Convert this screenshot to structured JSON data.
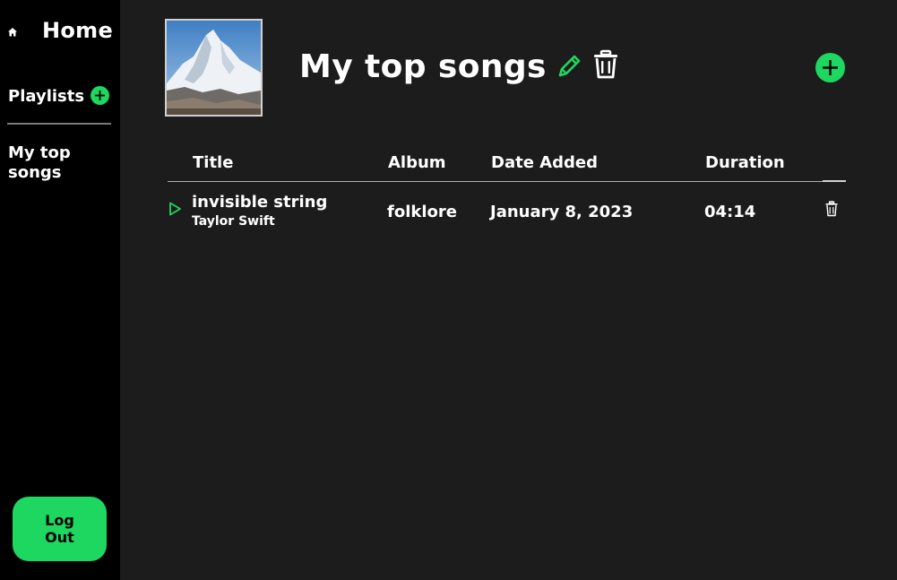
{
  "colors": {
    "accent": "#1ed760",
    "sidebar_bg": "#000000",
    "main_bg": "#1c1c1c",
    "text": "#ffffff"
  },
  "sidebar": {
    "home_icon": "home-icon",
    "home_label": "Home",
    "playlists_label": "Playlists",
    "add_playlist_icon": "add-circle-icon",
    "playlists": [
      {
        "label": "My top songs"
      }
    ],
    "logout_label": "Log Out"
  },
  "playlist": {
    "cover_alt": "Snowy mountain peak",
    "title": "My top songs",
    "edit_icon": "pencil-icon",
    "delete_icon": "trash-icon",
    "add_song_icon": "add-circle-icon"
  },
  "table": {
    "columns": [
      "Title",
      "Album",
      "Date Added",
      "Duration"
    ],
    "rows": [
      {
        "title": "invisible string",
        "artist": "Taylor Swift",
        "album": "folklore",
        "date_added": "January 8, 2023",
        "duration": "04:14",
        "play_icon": "play-icon",
        "delete_icon": "trash-icon"
      }
    ]
  }
}
